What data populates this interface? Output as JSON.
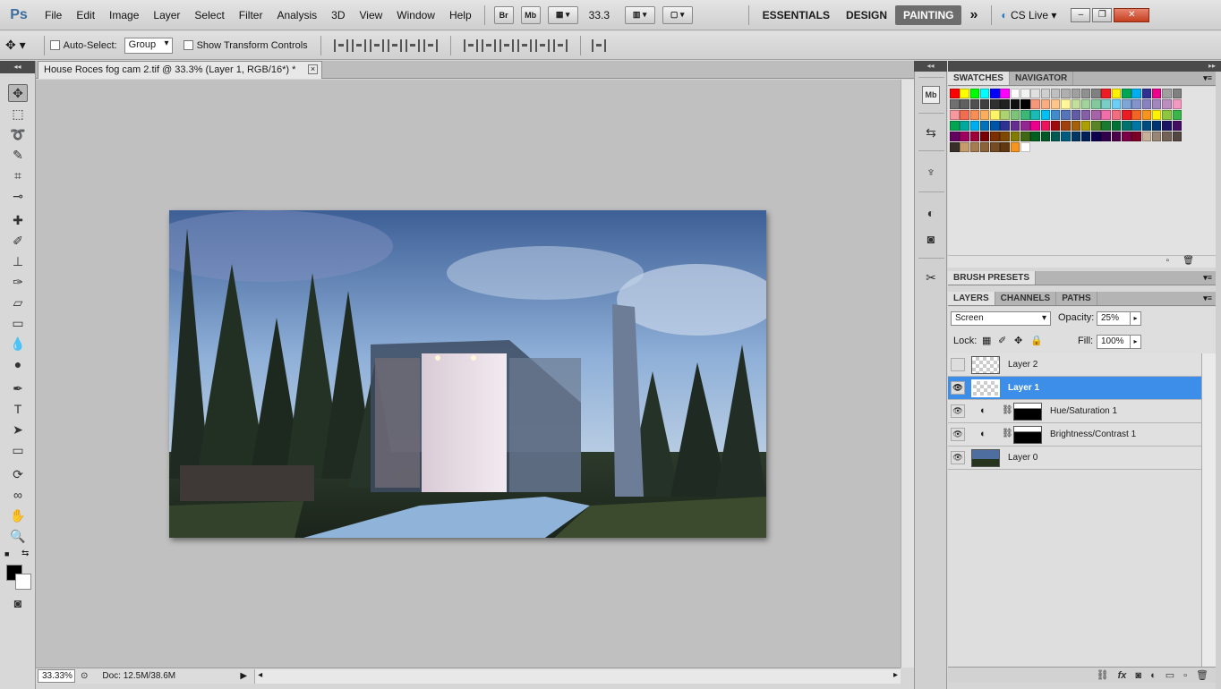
{
  "app": {
    "logo": "Ps"
  },
  "menu": [
    "File",
    "Edit",
    "Image",
    "Layer",
    "Select",
    "Filter",
    "Analysis",
    "3D",
    "View",
    "Window",
    "Help"
  ],
  "menubar": {
    "bridge_label": "Br",
    "minibridge_label": "Mb",
    "zoom_value": "33.3",
    "workspaces": [
      "ESSENTIALS",
      "DESIGN",
      "PAINTING"
    ],
    "active_workspace": "PAINTING",
    "more": "»",
    "cslive": "CS Live"
  },
  "options": {
    "auto_select_label": "Auto-Select:",
    "auto_select_value": "Group",
    "transform_label": "Show Transform Controls"
  },
  "document": {
    "tab_title": "House Roces fog cam 2.tif @ 33.3% (Layer 1, RGB/16*) *",
    "close": "×"
  },
  "status": {
    "zoom": "33.33%",
    "doc_info": "Doc: 12.5M/38.6M"
  },
  "panels": {
    "swatches_tab": "SWATCHES",
    "navigator_tab": "NAVIGATOR",
    "brush_presets_tab": "BRUSH PRESETS",
    "layers_tab": "LAYERS",
    "channels_tab": "CHANNELS",
    "paths_tab": "PATHS"
  },
  "layers_controls": {
    "blend_mode": "Screen",
    "opacity_label": "Opacity:",
    "opacity_value": "25%",
    "lock_label": "Lock:",
    "fill_label": "Fill:",
    "fill_value": "100%"
  },
  "layers": [
    {
      "name": "Layer 2",
      "visible": false,
      "selected": false
    },
    {
      "name": "Layer 1",
      "visible": true,
      "selected": true
    },
    {
      "name": "Hue/Saturation 1",
      "visible": true,
      "selected": false
    },
    {
      "name": "Brightness/Contrast 1",
      "visible": true,
      "selected": false
    },
    {
      "name": "Layer 0",
      "visible": true,
      "selected": false
    }
  ],
  "swatch_colors": [
    "#ff0000",
    "#ffff00",
    "#00ff00",
    "#00ffff",
    "#0000ff",
    "#ff00ff",
    "#ffffff",
    "#f2f2f2",
    "#e0e0e0",
    "#cfcfcf",
    "#bfbfbf",
    "#afafaf",
    "#a0a0a0",
    "#909090",
    "#808080",
    "#ed1c24",
    "#fff200",
    "#00a651",
    "#00aeef",
    "#2e3192",
    "#ec008c",
    "#a0a0a0",
    "#808080",
    "#707070",
    "#606060",
    "#505050",
    "#404040",
    "#303030",
    "#202020",
    "#101010",
    "#000000",
    "#f7977a",
    "#f9ad81",
    "#fdc68a",
    "#fff79a",
    "#c4df9b",
    "#a2d39c",
    "#82ca9d",
    "#7bcdc8",
    "#6ecff6",
    "#7ea7d8",
    "#8493ca",
    "#8882be",
    "#a187be",
    "#bc8dbf",
    "#f49ac2",
    "#f6989d",
    "#f26c4f",
    "#f68e55",
    "#fbaf5c",
    "#fff467",
    "#acd372",
    "#7cc576",
    "#3bb878",
    "#1abbb4",
    "#00bff3",
    "#438ccb",
    "#5574b9",
    "#605ca8",
    "#855fa8",
    "#a763a8",
    "#f06ea9",
    "#f26d7d",
    "#ed1c24",
    "#f26522",
    "#f7941d",
    "#fff200",
    "#8dc63f",
    "#39b54a",
    "#00a651",
    "#00a99d",
    "#00aeef",
    "#0072bc",
    "#0054a6",
    "#2e3192",
    "#662d91",
    "#92278f",
    "#ec008c",
    "#ed145b",
    "#9e0b0f",
    "#a0410d",
    "#a36209",
    "#aba000",
    "#598527",
    "#1a7b30",
    "#007236",
    "#00746b",
    "#0076a3",
    "#004b80",
    "#003471",
    "#1b1464",
    "#440e62",
    "#630460",
    "#9e005d",
    "#9e0039",
    "#790000",
    "#7b2e00",
    "#7d4900",
    "#827b00",
    "#406618",
    "#005e20",
    "#005826",
    "#005952",
    "#005b7f",
    "#003663",
    "#002157",
    "#0d004c",
    "#32004b",
    "#4b0049",
    "#7b0046",
    "#7a0026",
    "#c7b299",
    "#998675",
    "#736357",
    "#534741",
    "#37302a",
    "#c69c6d",
    "#a67c52",
    "#8c6239",
    "#754c24",
    "#603913",
    "#f7941d",
    "#ffffff"
  ]
}
